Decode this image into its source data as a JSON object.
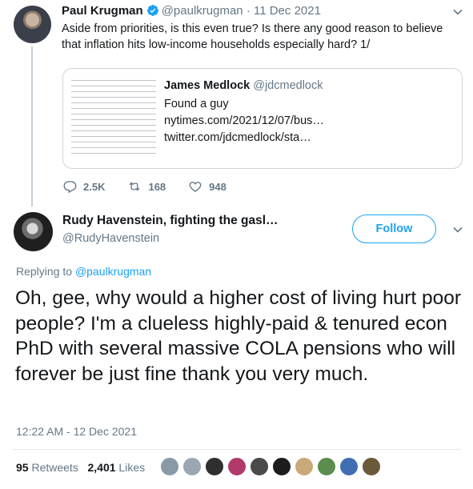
{
  "parent": {
    "name": "Paul Krugman",
    "handle": "@paulkrugman",
    "separator": "·",
    "date": "11 Dec 2021",
    "text": "Aside from priorities, is this even true? Is there any good reason to believe that inflation hits low-income households especially hard? 1/",
    "quote": {
      "name": "James Medlock",
      "handle": "@jdcmedlock",
      "line1": "Found a guy",
      "line2": "nytimes.com/2021/12/07/bus…",
      "line3": "twitter.com/jdcmedlock/sta…"
    },
    "actions": {
      "replies": "2.5K",
      "retweets": "168",
      "likes": "948"
    }
  },
  "main": {
    "name": "Rudy Havenstein, fighting the gasl…",
    "handle": "@RudyHavenstein",
    "follow_label": "Follow",
    "replying_prefix": "Replying to ",
    "replying_handle": "@paulkrugman",
    "text": "Oh, gee, why would a higher cost of living hurt poor people? I'm a clueless highly-paid & tenured econ PhD with several massive COLA pensions who will forever be just fine thank you very much.",
    "timestamp": "12:22 AM - 12 Dec 2021",
    "retweets_count": "95",
    "retweets_label": " Retweets",
    "likes_count": "2,401",
    "likes_label": " Likes"
  },
  "colors": {
    "accent": "#1da1f2",
    "muted": "#657786",
    "liker_avatars": [
      "#8a99a6",
      "#9aa7b1",
      "#2f2f2f",
      "#b23a6b",
      "#4a4a4a",
      "#1c1c1c",
      "#c9a97a",
      "#5b8d4e",
      "#3f6fb0",
      "#6a5a3a"
    ]
  }
}
